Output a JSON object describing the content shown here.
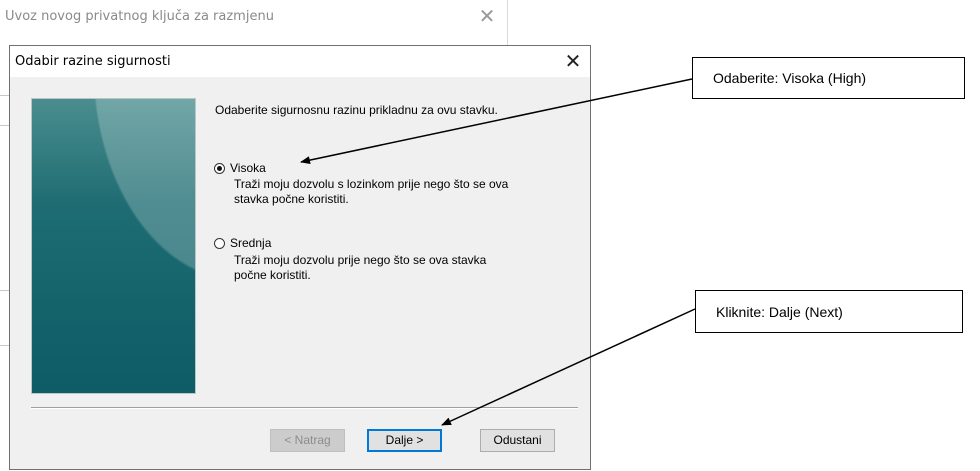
{
  "parent_window": {
    "title": "Uvoz novog privatnog ključa za razmjenu"
  },
  "dialog": {
    "title": "Odabir razine sigurnosti",
    "prompt": "Odaberite sigurnosnu razinu prikladnu za ovu stavku.",
    "options": [
      {
        "label": "Visoka",
        "description_line1": "Traži moju dozvolu s lozinkom prije nego što se ova",
        "description_line2": "stavka počne koristiti.",
        "selected": true
      },
      {
        "label": "Srednja",
        "description_line1": "Traži moju dozvolu prije nego što se ova stavka",
        "description_line2": "počne koristiti.",
        "selected": false
      }
    ],
    "buttons": {
      "back": "< Natrag",
      "next": "Dalje >",
      "cancel": "Odustani"
    }
  },
  "callouts": {
    "select_high": "Odaberite: Visoka (High)",
    "click_next": "Kliknite: Dalje (Next)"
  },
  "icons": {
    "close": "close-icon",
    "radio_checked": "radio-checked-icon",
    "radio_unchecked": "radio-unchecked-icon"
  },
  "colors": {
    "banner_top": "#4a8d8e",
    "banner_bottom": "#0e5c66",
    "primary_button_border": "#0078d7",
    "dialog_background": "#f0f0f0"
  }
}
